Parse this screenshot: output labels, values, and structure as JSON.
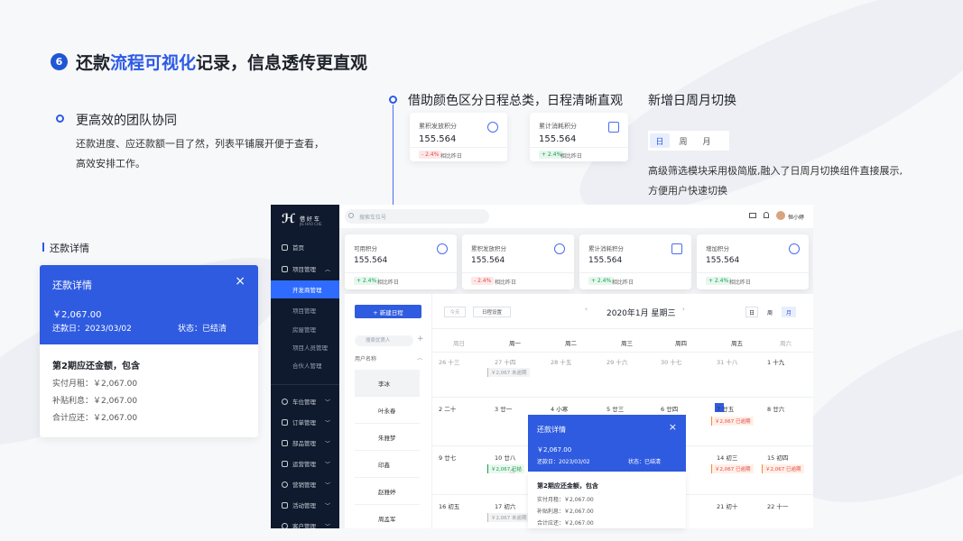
{
  "slide": {
    "step_number": "6",
    "headline_before": "还款",
    "headline_highlight": "流程可视化",
    "headline_after": "记录，信息透传更直观"
  },
  "section_team": {
    "title": "更高效的团队协同",
    "desc_line1": "还款进度、应还款额一目了然，列表平铺展开便于查看，",
    "desc_line2": "高效安排工作。"
  },
  "section_color": {
    "title": "借助颜色区分日程总类，日程清晰直观"
  },
  "section_toggle": {
    "title": "新增日周月切换",
    "desc_line1": "高级筛选模块采用极简版,融入了日周月切换组件直接展示,",
    "desc_line2": "方便用户快速切换",
    "options": [
      "日",
      "周",
      "月"
    ]
  },
  "mini_cards": [
    {
      "label": "累积发放积分",
      "value": "155.564",
      "badge": "- 2.4%",
      "compare": "相比昨日"
    },
    {
      "label": "累计消耗积分",
      "value": "155.564",
      "badge": "+ 2.4%",
      "compare": "相比昨日"
    }
  ],
  "left_detail": {
    "heading": "还款详情",
    "title": "还款详情",
    "amount": "￥2,067.00",
    "date": "还款日：2023/03/02",
    "status": "状态：已结清",
    "period": "第2期应还金额，包含",
    "rows": [
      "实付月租：￥2,067.00",
      "补贴利息：￥2,067.00",
      "合计应还：￥2,067.00"
    ]
  },
  "app": {
    "logo_text": "借 好 车",
    "logo_sub": "JIE HAO CHE",
    "search_placeholder": "搜索车位号",
    "user_name": "恒小婷",
    "nav": {
      "home": "首页",
      "project": "项目管理",
      "project_subs": [
        "开发商管理",
        "项目管理",
        "房屋管理",
        "项目人员管理",
        "合伙人管理"
      ],
      "groups": [
        "车位管理",
        "订单管理",
        "部品管理",
        "运营管理",
        "营销管理",
        "活动管理",
        "客户管理"
      ]
    },
    "kpis": [
      {
        "label": "可用积分",
        "value": "155.564",
        "badge": "+ 2.4%",
        "compare": "相比昨日"
      },
      {
        "label": "累积发放积分",
        "value": "155.564",
        "badge": "- 2.4%",
        "compare": "相比昨日"
      },
      {
        "label": "累计消耗积分",
        "value": "155.564",
        "badge": "+ 2.4%",
        "compare": "相比昨日"
      },
      {
        "label": "增加积分",
        "value": "155.564",
        "badge": "+ 2.4%",
        "compare": "相比昨日"
      }
    ],
    "calendar": {
      "new_button": "+ 新建日程",
      "today": "今天",
      "settings": "日程设置",
      "month_label": "2020年1月  星期三",
      "views": [
        "日",
        "周",
        "月"
      ],
      "person_search": "搜索优质人",
      "person_header": "用户名称",
      "persons": [
        "李冰",
        "叶永春",
        "朱雅梦",
        "印鑫",
        "赵雅婷",
        "周孟军"
      ],
      "weekdays": [
        "周日",
        "周一",
        "周二",
        "周三",
        "周四",
        "周五",
        "周六"
      ],
      "rows": [
        [
          "26 十三",
          "27 十四",
          "28 十五",
          "29 十六",
          "30 十七",
          "31 十八",
          "1 十九"
        ],
        [
          "2 二十",
          "3 廿一",
          "4 小寒",
          "5 廿三",
          "6 廿四",
          "7 廿五",
          "8 廿六"
        ],
        [
          "9 廿七",
          "10 廿八",
          "",
          "",
          "",
          "14 初三",
          "15 初四"
        ],
        [
          "16 初五",
          "17 初六",
          "",
          "",
          "",
          "21 初十",
          "22 十一"
        ]
      ],
      "events": {
        "grey1": "￥2,067  未逾期",
        "red1": "￥2,067  已逾期",
        "green": "￥2,067  已结",
        "red2": "￥2,067  已逾期",
        "red3": "￥2,067  已逾期",
        "grey2": "￥2,067  未逾期"
      },
      "popup": {
        "title": "还款详情",
        "amount": "￥2,067.00",
        "date": "还款日：2023/03/02",
        "status": "状态：已结清",
        "period": "第2期应还金额，包含",
        "rows": [
          "实付月租：￥2,067.00",
          "补贴利息：￥2,067.00",
          "合计应还：￥2,067.00"
        ]
      }
    }
  }
}
